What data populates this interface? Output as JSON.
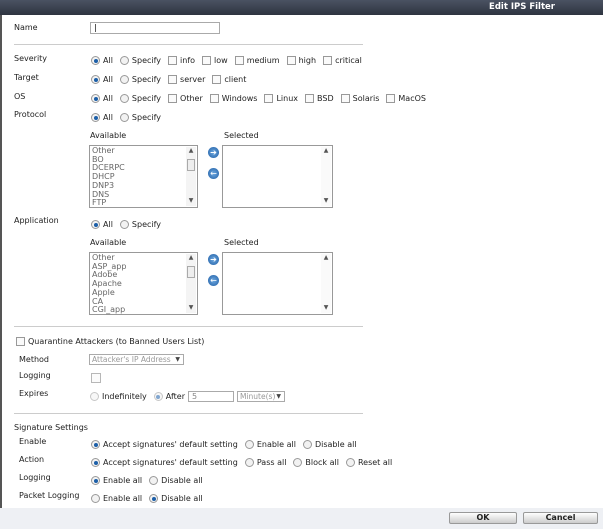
{
  "title": "Edit IPS Filter",
  "name": {
    "label": "Name",
    "value": ""
  },
  "severity": {
    "label": "Severity",
    "all": "All",
    "specify": "Specify",
    "options": [
      "info",
      "low",
      "medium",
      "high",
      "critical"
    ]
  },
  "target": {
    "label": "Target",
    "all": "All",
    "specify": "Specify",
    "options": [
      "server",
      "client"
    ]
  },
  "os": {
    "label": "OS",
    "all": "All",
    "specify": "Specify",
    "options": [
      "Other",
      "Windows",
      "Linux",
      "BSD",
      "Solaris",
      "MacOS"
    ]
  },
  "protocol": {
    "label": "Protocol",
    "all": "All",
    "specify": "Specify",
    "available_label": "Available",
    "selected_label": "Selected",
    "available": [
      "Other",
      "BO",
      "DCERPC",
      "DHCP",
      "DNP3",
      "DNS",
      "FTP"
    ]
  },
  "application": {
    "label": "Application",
    "all": "All",
    "specify": "Specify",
    "available_label": "Available",
    "selected_label": "Selected",
    "available": [
      "Other",
      "ASP_app",
      "Adobe",
      "Apache",
      "Apple",
      "CA",
      "CGI_app"
    ]
  },
  "quarantine": {
    "label": "Quarantine Attackers (to Banned Users List)",
    "method_label": "Method",
    "method_value": "Attacker's IP Address",
    "logging_label": "Logging",
    "expires_label": "Expires",
    "indefinitely": "Indefinitely",
    "after": "After",
    "after_value": "5",
    "unit": "Minute(s)"
  },
  "signature": {
    "heading": "Signature Settings",
    "enable": {
      "label": "Enable",
      "options": [
        "Accept signatures' default setting",
        "Enable all",
        "Disable all"
      ]
    },
    "action": {
      "label": "Action",
      "options": [
        "Accept signatures' default setting",
        "Pass all",
        "Block all",
        "Reset all"
      ]
    },
    "logging": {
      "label": "Logging",
      "options": [
        "Enable all",
        "Disable all"
      ]
    },
    "packet_logging": {
      "label": "Packet Logging",
      "options": [
        "Enable all",
        "Disable all"
      ]
    }
  },
  "buttons": {
    "ok": "OK",
    "cancel": "Cancel"
  }
}
